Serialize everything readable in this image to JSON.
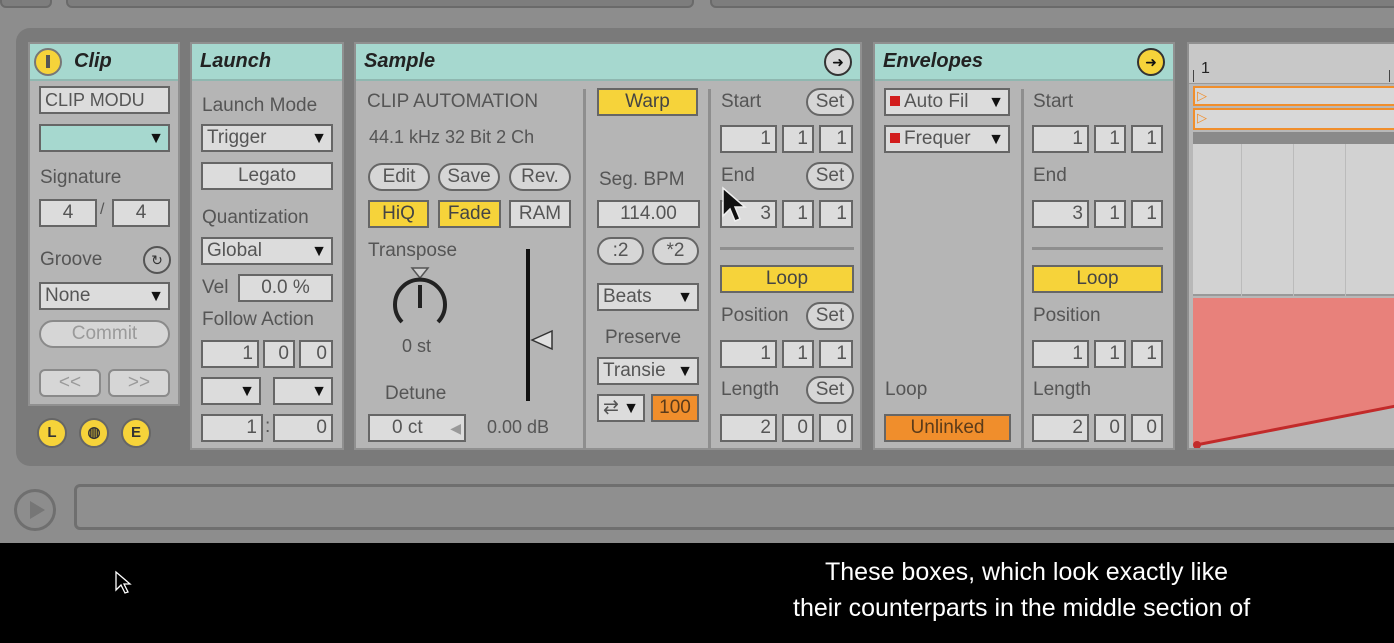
{
  "clip": {
    "title": "Clip",
    "name_value": "CLIP MODU",
    "signature_label": "Signature",
    "sig_num": "4",
    "sig_sep": "/",
    "sig_den": "4",
    "groove_label": "Groove",
    "groove_value": "None",
    "commit_label": "Commit",
    "nav_prev": "<<",
    "nav_next": ">>",
    "btn_l": "L",
    "btn_e": "E"
  },
  "launch": {
    "title": "Launch",
    "mode_label": "Launch Mode",
    "mode_value": "Trigger",
    "legato_label": "Legato",
    "quant_label": "Quantization",
    "quant_value": "Global",
    "vel_label": "Vel",
    "vel_value": "0.0 %",
    "follow_label": "Follow Action",
    "follow_time": [
      "1",
      "0",
      "0"
    ],
    "chance_a": "1",
    "chance_sep": ":",
    "chance_b": "0"
  },
  "sample": {
    "title": "Sample",
    "automation_label": "CLIP AUTOMATION",
    "format": "44.1 kHz 32 Bit 2 Ch",
    "edit_label": "Edit",
    "save_label": "Save",
    "rev_label": "Rev.",
    "hiq_label": "HiQ",
    "fade_label": "Fade",
    "ram_label": "RAM",
    "transpose_label": "Transpose",
    "transpose_value": "0 st",
    "detune_label": "Detune",
    "detune_value": "0 ct",
    "gain_value": "0.00 dB",
    "warp_label": "Warp",
    "seg_bpm_label": "Seg. BPM",
    "seg_bpm_value": "114.00",
    "half_label": ":2",
    "double_label": "*2",
    "warp_mode": "Beats",
    "preserve_label": "Preserve",
    "preserve_value": "Transie",
    "loop_mode": "⇄",
    "envelope_value": "100",
    "start_label": "Start",
    "set_label": "Set",
    "start_values": [
      "1",
      "1",
      "1"
    ],
    "end_label": "End",
    "end_values": [
      "3",
      "1",
      "1"
    ],
    "loop_label": "Loop",
    "position_label": "Position",
    "position_values": [
      "1",
      "1",
      "1"
    ],
    "length_label": "Length",
    "length_values": [
      "2",
      "0",
      "0"
    ]
  },
  "envelopes": {
    "title": "Envelopes",
    "device_value": "Auto Fil",
    "param_value": "Frequer",
    "loop_label": "Loop",
    "unlinked_label": "Unlinked",
    "start_label": "Start",
    "start_values": [
      "1",
      "1",
      "1"
    ],
    "end_label": "End",
    "end_values": [
      "3",
      "1",
      "1"
    ],
    "loop_button_label": "Loop",
    "position_label": "Position",
    "position_values": [
      "1",
      "1",
      "1"
    ],
    "length_label": "Length",
    "length_values": [
      "2",
      "0",
      "0"
    ]
  },
  "editor": {
    "ruler_mark": "1",
    "envelope_color": "#e8817b"
  },
  "subtitle": {
    "line1": "These boxes, which look exactly like",
    "line2": "their counterparts in the middle section of"
  }
}
